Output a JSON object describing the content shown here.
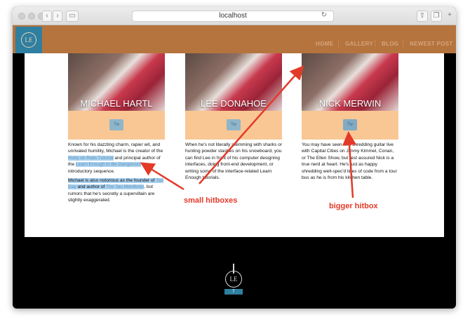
{
  "browser": {
    "url": "localhost"
  },
  "header": {
    "logo_text": "LE",
    "menu": [
      "HOME",
      "GALLERY",
      "BLOG",
      "NEWEST POST"
    ]
  },
  "cards": [
    {
      "name": "MICHAEL HARTL",
      "twitter_label": "Tw",
      "p1_a": "Known for his dazzling charm, rapier wit, and unrivaled humility, Michael is the creator of the ",
      "p1_link1": "Ruby on Rails Tutorial",
      "p1_b": " and principal author of the ",
      "p1_link2": "Learn Enough to Be Dangerous",
      "p1_c": " introductory sequence.",
      "p2_a": "Michael is also notorious as the founder of ",
      "p2_link1": "Tau Day",
      "p2_b": " and author of ",
      "p2_link2": "The Tau Manifesto",
      "p2_c": ", but rumors that he's secretly a supervillain are slightly exaggerated."
    },
    {
      "name": "LEE DONAHOE",
      "twitter_label": "Tw",
      "p1": "When he's not literally swimming with sharks or hunting powder stashes on his snowboard, you can find Lee in front of his computer designing interfaces, doing front-end development, or writing some of the interface-related Learn Enough tutorials."
    },
    {
      "name": "NICK MERWIN",
      "twitter_label": "Tw",
      "p1": "You may have seen him shredding guitar live with Capital Cities on Jimmy Kimmel, Conan, or The Ellen Show, but rest assured Nick is a true nerd at heart. He's just as happy shredding well-spec'd lines of code from a tour bus as he is from his kitchen table."
    }
  ],
  "footer": {
    "logo_text": "LE",
    "twitter_label": "T"
  },
  "annotations": {
    "small": "small hitboxes",
    "big": "bigger hitbox"
  },
  "colors": {
    "header": "#b5743e",
    "logo": "#2f7fa0",
    "peach": "#f9c794",
    "highlight": "#a8d1ef",
    "annotation": "#e33a28"
  }
}
